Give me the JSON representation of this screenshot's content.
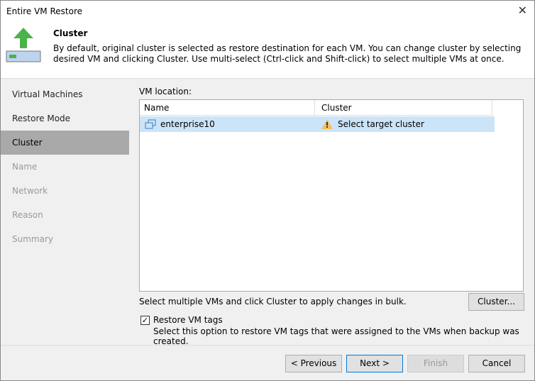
{
  "window": {
    "title": "Entire VM Restore",
    "close": "✕"
  },
  "header": {
    "title": "Cluster",
    "description": "By default, original cluster is selected as restore destination for each VM. You can change cluster by selecting desired VM and clicking Cluster. Use multi-select (Ctrl-click and Shift-click) to select multiple VMs at once."
  },
  "steps": [
    "Virtual Machines",
    "Restore Mode",
    "Cluster",
    "Name",
    "Network",
    "Reason",
    "Summary"
  ],
  "main": {
    "location_label": "VM location:",
    "columns": [
      "Name",
      "Cluster"
    ],
    "rows": [
      {
        "name": "enterprise10",
        "cluster": "Select target cluster"
      }
    ],
    "bulk_note": "Select multiple VMs and click Cluster to apply changes in bulk.",
    "cluster_button": "Cluster...",
    "restore_tags": {
      "label": "Restore VM tags",
      "checked": true,
      "mark": "✓",
      "description": "Select this option to restore VM tags that were assigned to the VMs when backup was created."
    }
  },
  "footer": {
    "previous": "< Previous",
    "next": "Next >",
    "finish": "Finish",
    "cancel": "Cancel"
  }
}
